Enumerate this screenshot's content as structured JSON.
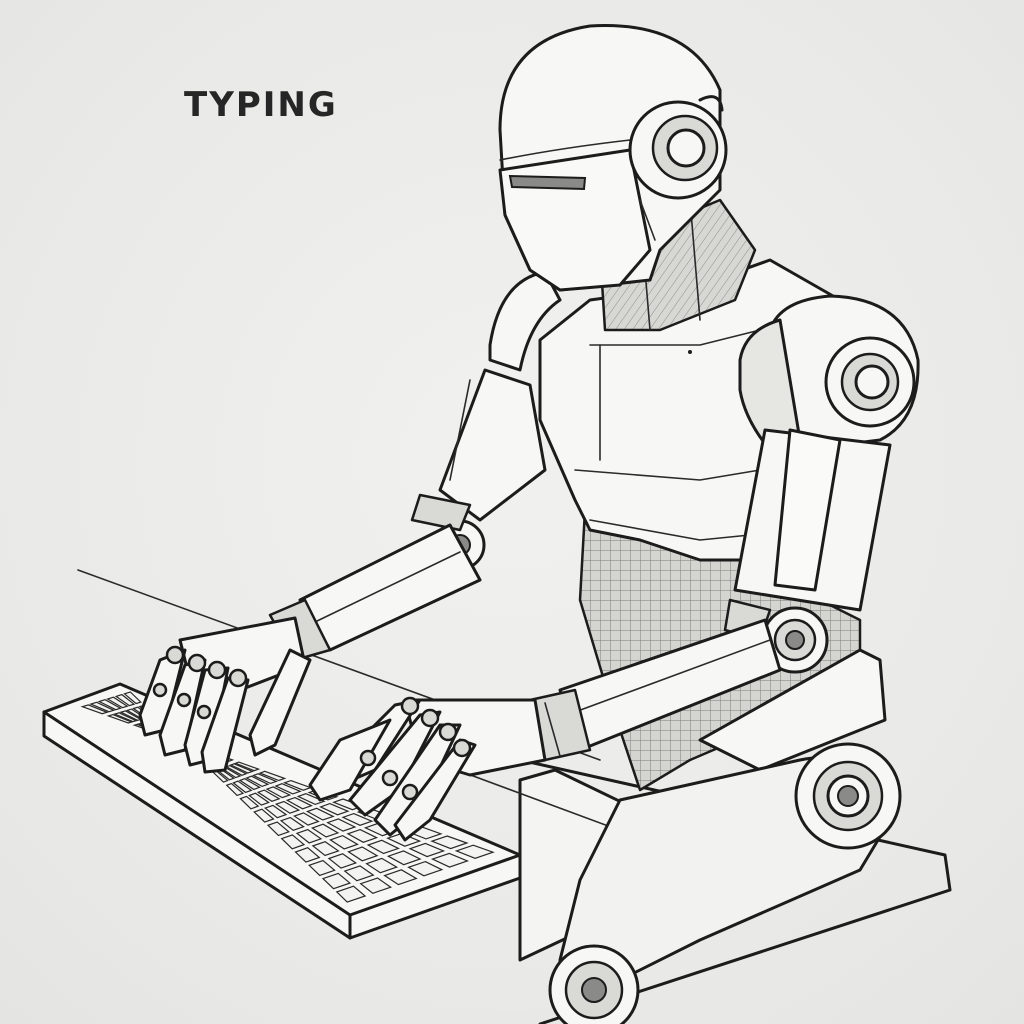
{
  "caption": "TYPING",
  "illustration": {
    "subject": "robot",
    "object": "keyboard",
    "style": "line-art sketch",
    "colors": {
      "background": "#ebebea",
      "line": "#1c1c1c",
      "shade": "#d9d9d6",
      "mesh": "#cfcfcb"
    }
  }
}
